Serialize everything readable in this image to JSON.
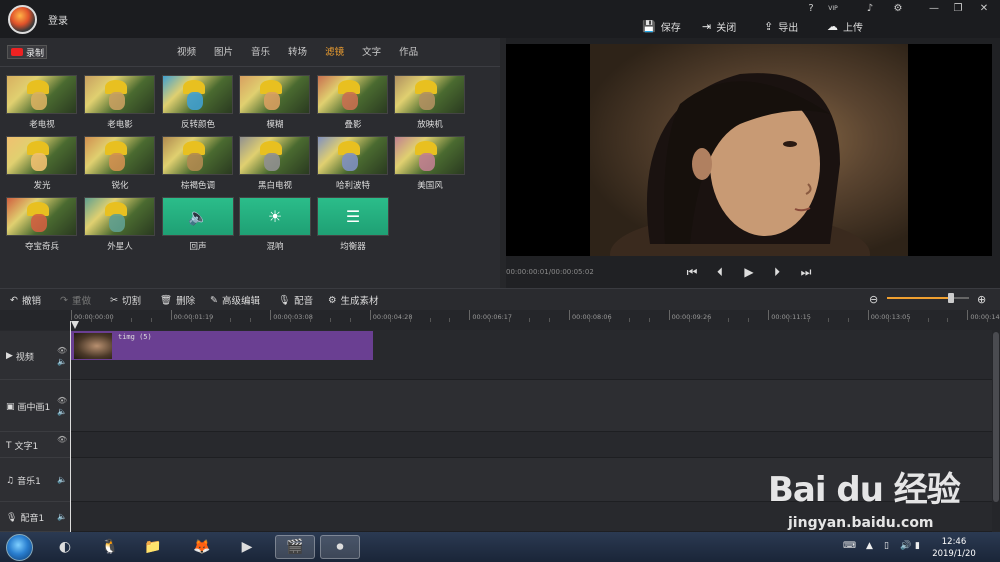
{
  "header": {
    "login_label": "登录",
    "top_icons": [
      "question-icon",
      "vip-icon",
      "bell-icon",
      "gear-icon",
      "minimize-icon",
      "restore-icon",
      "close-icon"
    ],
    "top_icon_glyphs": [
      "?",
      "VIP",
      "♪",
      "⚙",
      "—",
      "❐",
      "✕"
    ],
    "actions": [
      {
        "label": "保存",
        "icon": "save-icon",
        "glyph": "💾"
      },
      {
        "label": "关闭",
        "icon": "close-doc-icon",
        "glyph": "⇥"
      },
      {
        "label": "导出",
        "icon": "export-icon",
        "glyph": "⇪"
      },
      {
        "label": "上传",
        "icon": "cloud-upload-icon",
        "glyph": "☁"
      }
    ]
  },
  "panel": {
    "record_label": "录制",
    "tabs": [
      "视频",
      "图片",
      "音乐",
      "转场",
      "滤镜",
      "文字",
      "作品"
    ],
    "active_tab": "滤镜",
    "filters": [
      {
        "label": "老电视",
        "kind": "photo",
        "hue": "#d8b060"
      },
      {
        "label": "老电影",
        "kind": "photo",
        "hue": "#c8a060"
      },
      {
        "label": "反转颜色",
        "kind": "photo",
        "hue": "#40a0d0"
      },
      {
        "label": "模糊",
        "kind": "photo",
        "hue": "#d8a060"
      },
      {
        "label": "叠影",
        "kind": "photo",
        "hue": "#c87050"
      },
      {
        "label": "放映机",
        "kind": "photo",
        "hue": "#b09060"
      },
      {
        "label": "发光",
        "kind": "photo",
        "hue": "#f0c070"
      },
      {
        "label": "锐化",
        "kind": "photo",
        "hue": "#d09050"
      },
      {
        "label": "棕褐色调",
        "kind": "photo",
        "hue": "#b08a50"
      },
      {
        "label": "黑白电视",
        "kind": "photo",
        "hue": "#909090"
      },
      {
        "label": "哈利波特",
        "kind": "photo",
        "hue": "#8090c0"
      },
      {
        "label": "美国风",
        "kind": "photo",
        "hue": "#c08090"
      },
      {
        "label": "夺宝奇兵",
        "kind": "photo",
        "hue": "#d06040"
      },
      {
        "label": "外星人",
        "kind": "photo",
        "hue": "#60a090"
      },
      {
        "label": "回声",
        "kind": "icon",
        "glyph": "🔈"
      },
      {
        "label": "混响",
        "kind": "icon",
        "glyph": "☀"
      },
      {
        "label": "均衡器",
        "kind": "icon",
        "glyph": "☰"
      }
    ]
  },
  "preview": {
    "timecode": "00:00:00:01/00:00:05:02",
    "controls": [
      {
        "name": "skip-start-icon",
        "glyph": "⏮"
      },
      {
        "name": "step-back-icon",
        "glyph": "⏴"
      },
      {
        "name": "play-icon",
        "glyph": "▶"
      },
      {
        "name": "step-forward-icon",
        "glyph": "⏵"
      },
      {
        "name": "skip-end-icon",
        "glyph": "⏭"
      }
    ]
  },
  "toolbar": {
    "items": [
      {
        "label": "撤销",
        "icon": "undo-icon",
        "glyph": "↶",
        "enabled": true
      },
      {
        "label": "重做",
        "icon": "redo-icon",
        "glyph": "↷",
        "enabled": false
      },
      {
        "label": "切割",
        "icon": "scissors-icon",
        "glyph": "✂",
        "enabled": true
      },
      {
        "label": "删除",
        "icon": "trash-icon",
        "glyph": "🗑",
        "enabled": true
      },
      {
        "label": "高级编辑",
        "icon": "pencil-icon",
        "glyph": "✎",
        "enabled": true
      },
      {
        "label": "配音",
        "icon": "microphone-icon",
        "glyph": "🎙",
        "enabled": true
      },
      {
        "label": "生成素材",
        "icon": "film-reel-icon",
        "glyph": "⚙",
        "enabled": true
      }
    ],
    "zoom_level": 0.78
  },
  "ruler": {
    "labels": [
      "00:00:00:00",
      "00:00:01:19",
      "00:00:03:08",
      "00:00:04:28",
      "00:00:06:17",
      "00:00:08:06",
      "00:00:09:26",
      "00:00:11:15",
      "00:00:13:05",
      "00:00:14:"
    ]
  },
  "tracks": [
    {
      "label": "视频",
      "icon": "video-track-icon",
      "glyph": "▶",
      "eye": true,
      "audio": true
    },
    {
      "label": "画中画1",
      "icon": "pip-track-icon",
      "glyph": "▣",
      "eye": true,
      "audio": true
    },
    {
      "label": "文字1",
      "icon": "text-track-icon",
      "glyph": "T",
      "eye": true,
      "audio": false
    },
    {
      "label": "音乐1",
      "icon": "music-track-icon",
      "glyph": "♫",
      "eye": false,
      "audio": true
    },
    {
      "label": "配音1",
      "icon": "mic-track-icon",
      "glyph": "🎙",
      "eye": false,
      "audio": true
    }
  ],
  "clip": {
    "label": "timg (5)"
  },
  "taskbar": {
    "apps": [
      {
        "name": "360-browser-icon",
        "glyph": "◐"
      },
      {
        "name": "qq-icon",
        "glyph": "🐧"
      },
      {
        "name": "file-explorer-icon",
        "glyph": "📁"
      },
      {
        "name": "firefox-icon",
        "glyph": "🦊"
      },
      {
        "name": "media-player-icon",
        "glyph": "▶"
      },
      {
        "name": "video-editor-icon",
        "glyph": "🎬"
      },
      {
        "name": "screen-recorder-icon",
        "glyph": "⏺"
      }
    ],
    "time": "12:46",
    "date": "2019/1/20"
  },
  "watermark": {
    "brand": "Bai du 经验",
    "url": "jingyan.baidu.com"
  },
  "colors": {
    "accent": "#f0a030",
    "clip": "#6a3f92",
    "filter_green": "#2bbd8a"
  }
}
